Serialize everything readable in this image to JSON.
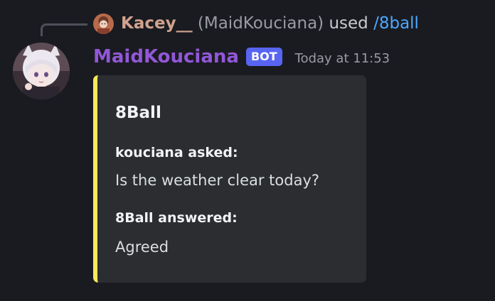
{
  "reply": {
    "user": "Kacey__",
    "handle": "(MaidKouciana)",
    "action": "used",
    "command": "/8ball"
  },
  "message": {
    "author": "MaidKouciana",
    "badge": "BOT",
    "timestamp": "Today at 11:53"
  },
  "embed": {
    "title": "8Ball",
    "accent_color": "#fee75c",
    "fields": [
      {
        "name": "kouciana asked:",
        "value": "Is the weather clear today?"
      },
      {
        "name": "8Ball answered:",
        "value": "Agreed"
      }
    ]
  },
  "colors": {
    "author_name": "#9257d8",
    "reply_user": "#d0a38e",
    "command_link": "#4da8ff",
    "bot_badge": "#5865f2"
  }
}
